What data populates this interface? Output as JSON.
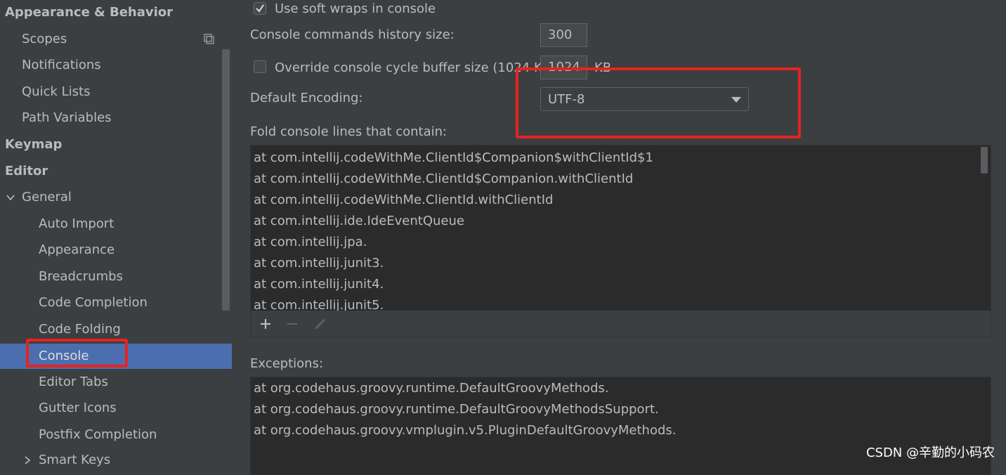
{
  "sidebar": {
    "items": [
      {
        "label": "Appearance & Behavior",
        "bold": true
      },
      {
        "label": "Scopes"
      },
      {
        "label": "Notifications"
      },
      {
        "label": "Quick Lists"
      },
      {
        "label": "Path Variables"
      },
      {
        "label": "Keymap",
        "bold": true
      },
      {
        "label": "Editor",
        "bold": true
      },
      {
        "label": "General"
      },
      {
        "label": "Auto Import"
      },
      {
        "label": "Appearance"
      },
      {
        "label": "Breadcrumbs"
      },
      {
        "label": "Code Completion"
      },
      {
        "label": "Code Folding"
      },
      {
        "label": "Console",
        "selected": true
      },
      {
        "label": "Editor Tabs"
      },
      {
        "label": "Gutter Icons"
      },
      {
        "label": "Postfix Completion"
      },
      {
        "label": "Smart Keys"
      }
    ]
  },
  "console": {
    "soft_wraps_label": "Use soft wraps in console",
    "soft_wraps_checked": true,
    "history_label": "Console commands history size:",
    "history_value": "300",
    "override_label": "Override console cycle buffer size (1024 KB)",
    "override_checked": false,
    "buffer_value": "1024",
    "buffer_unit": "KB",
    "encoding_label": "Default Encoding:",
    "encoding_value": "UTF-8",
    "fold_label": "Fold console lines that contain:",
    "fold_lines": [
      "at com.intellij.codeWithMe.ClientId$Companion$withClientId$1",
      "at com.intellij.codeWithMe.ClientId$Companion.withClientId",
      "at com.intellij.codeWithMe.ClientId.withClientId",
      "at com.intellij.ide.IdeEventQueue",
      "at com.intellij.jpa.",
      "at com.intellij.junit3.",
      "at com.intellij.junit4.",
      "at com.intellij.junit5."
    ],
    "exceptions_label": "Exceptions:",
    "exception_lines": [
      "at org.codehaus.groovy.runtime.DefaultGroovyMethods.",
      "at org.codehaus.groovy.runtime.DefaultGroovyMethodsSupport.",
      "at org.codehaus.groovy.vmplugin.v5.PluginDefaultGroovyMethods."
    ]
  },
  "watermark": "CSDN @辛勤的小码农",
  "colors": {
    "background": "#3c3f41",
    "selection": "#4b6eaf",
    "list_background": "#2b2b2b",
    "highlight_box": "#e8231f"
  },
  "icons": [
    "copy-icon",
    "chevron-down-icon",
    "chevron-right-icon",
    "checkmark-icon",
    "dropdown-arrow-icon",
    "add-icon",
    "remove-icon",
    "edit-icon"
  ]
}
